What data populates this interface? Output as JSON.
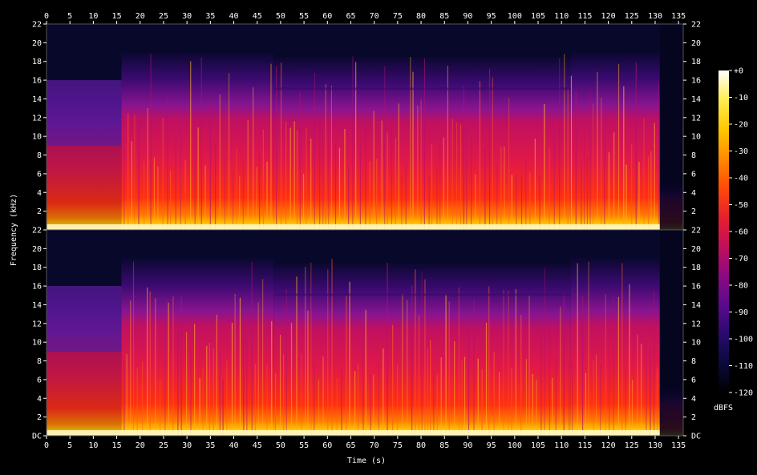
{
  "chart_data": {
    "type": "heatmap",
    "subtype": "spectrogram",
    "xlabel": "Time (s)",
    "ylabel": "Frequency (kHz)",
    "xlim": [
      0,
      136
    ],
    "x_ticks": [
      "0",
      "5",
      "10",
      "15",
      "20",
      "25",
      "30",
      "35",
      "40",
      "45",
      "50",
      "55",
      "60",
      "65",
      "70",
      "75",
      "80",
      "85",
      "90",
      "95",
      "100",
      "105",
      "110",
      "115",
      "120",
      "125",
      "130",
      "135"
    ],
    "channels": [
      {
        "ylim": [
          0,
          22
        ],
        "y_ticks": [
          "22",
          "20",
          "18",
          "16",
          "14",
          "12",
          "10",
          "8",
          "6",
          "4",
          "2"
        ]
      },
      {
        "ylim": [
          0,
          22
        ],
        "y_ticks": [
          "22",
          "20",
          "18",
          "16",
          "14",
          "12",
          "10",
          "8",
          "6",
          "4",
          "2",
          "DC"
        ]
      }
    ],
    "colorbar": {
      "unit": "dBFS",
      "range": [
        -120,
        0
      ],
      "ticks": [
        "+0",
        "-10",
        "-20",
        "-30",
        "-40",
        "-50",
        "-60",
        "-70",
        "-80",
        "-90",
        "-100",
        "-110",
        "-120"
      ],
      "colors": [
        "#000000",
        "#0a0a3c",
        "#2a0a6e",
        "#5a0a8c",
        "#8c0a82",
        "#c0105a",
        "#e8202e",
        "#ff4a0a",
        "#ff8c00",
        "#ffc800",
        "#ffee50",
        "#ffffff"
      ]
    },
    "sections": [
      {
        "t_start": 0,
        "t_end": 16,
        "max_freq_khz": 16,
        "note": ""
      },
      {
        "t_start": 16,
        "t_end": 48.5,
        "max_freq_khz": 19
      },
      {
        "t_start": 48.5,
        "t_end": 112,
        "max_freq_khz": 18.5
      },
      {
        "t_start": 112,
        "t_end": 131,
        "max_freq_khz": 19
      },
      {
        "t_start": 131,
        "t_end": 136,
        "max_freq_khz": 5
      }
    ],
    "grid": false,
    "legend": "right"
  }
}
